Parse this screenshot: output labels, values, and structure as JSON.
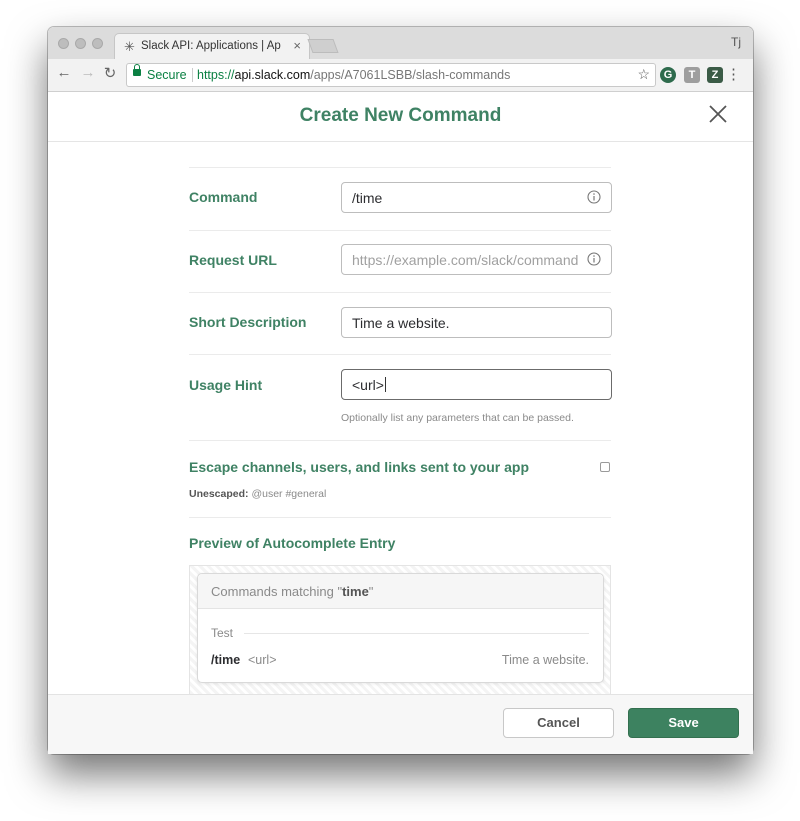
{
  "browser": {
    "tab_title": "Slack API: Applications | Apex",
    "tab_close": "×",
    "tab_favicon": "slack-icon",
    "profile_initials": "Tj",
    "secure_label": "Secure",
    "url_scheme": "https://",
    "url_domain": "api.slack.com",
    "url_path": "/apps/A7061LSBB/slash-commands",
    "extensions": [
      "grammarly-icon",
      "T",
      "Z"
    ]
  },
  "modal": {
    "title": "Create New Command",
    "fields": {
      "command": {
        "label": "Command",
        "value": "/time"
      },
      "request_url": {
        "label": "Request URL",
        "placeholder": "https://example.com/slack/command"
      },
      "short_description": {
        "label": "Short Description",
        "value": "Time a website."
      },
      "usage_hint": {
        "label": "Usage Hint",
        "value": "<url>",
        "help": "Optionally list any parameters that can be passed."
      }
    },
    "escape": {
      "label": "Escape channels, users, and links sent to your app",
      "checked": false,
      "unescaped_label": "Unescaped:",
      "unescaped_example": "@user #general"
    },
    "preview": {
      "heading": "Preview of Autocomplete Entry",
      "commands_matching_prefix": "Commands matching \"",
      "commands_matching_term": "time",
      "commands_matching_suffix": "\"",
      "section": "Test",
      "command": "/time",
      "hint": "<url>",
      "description": "Time a website."
    },
    "buttons": {
      "cancel": "Cancel",
      "save": "Save"
    }
  },
  "colors": {
    "accent_green": "#3f8264",
    "save_button": "#3d8260",
    "secure_green": "#0b8043"
  }
}
